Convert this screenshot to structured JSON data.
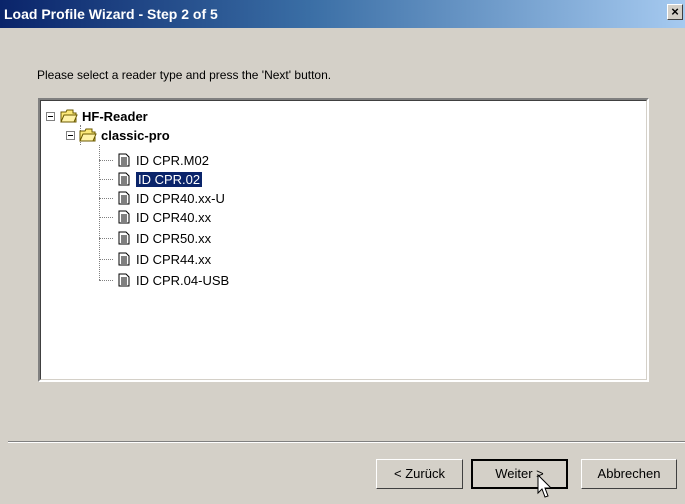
{
  "window": {
    "title": "Load Profile Wizard - Step 2 of 5",
    "close_label": "×"
  },
  "prompt": "Please select a reader type and press the 'Next' button.",
  "tree": {
    "root": "HF-Reader",
    "group": "classic-pro",
    "items": [
      "ID CPR.M02",
      "ID CPR.02",
      "ID CPR40.xx-U",
      "ID CPR40.xx",
      "ID CPR50.xx",
      "ID CPR44.xx",
      "ID CPR.04-USB"
    ],
    "selected": "ID CPR.02"
  },
  "buttons": {
    "back": "< Zurück",
    "next": "Weiter >",
    "cancel": "Abbrechen"
  },
  "colors": {
    "selection": "#0a246a",
    "face": "#d4d0c8"
  }
}
